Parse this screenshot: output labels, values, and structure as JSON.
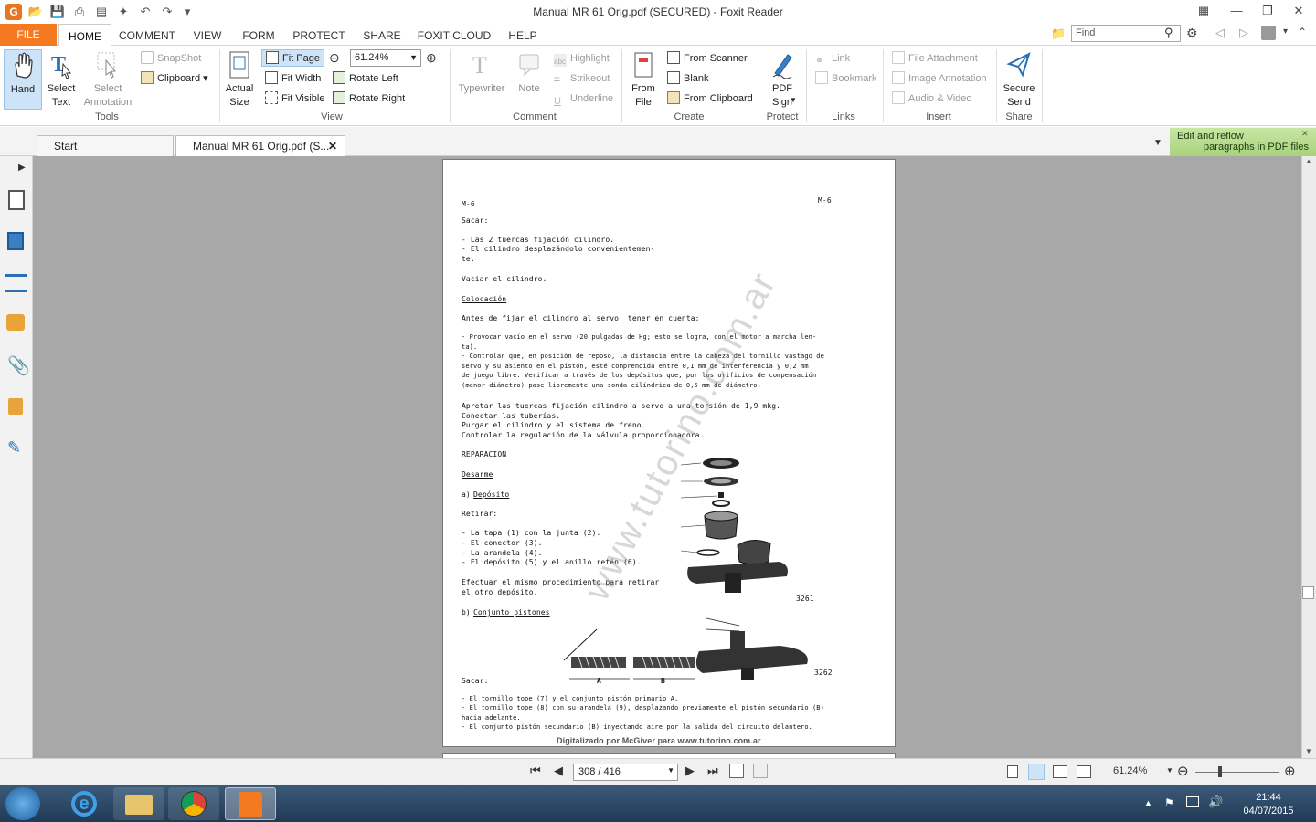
{
  "window": {
    "title": "Manual MR 61 Orig.pdf (SECURED) - Foxit Reader",
    "app_icon": "G"
  },
  "menu_tabs": [
    "FILE",
    "HOME",
    "COMMENT",
    "VIEW",
    "FORM",
    "PROTECT",
    "SHARE",
    "FOXIT CLOUD",
    "HELP"
  ],
  "search": {
    "placeholder": "Find"
  },
  "ribbon": {
    "tools": {
      "hand": "Hand",
      "select_text": "Select Text",
      "select_annotation": "Select Annotation",
      "snapshot": "SnapShot",
      "clipboard": "Clipboard",
      "group": "Tools"
    },
    "view": {
      "actual_size": "Actual Size",
      "fit_page": "Fit Page",
      "fit_width": "Fit Width",
      "fit_visible": "Fit Visible",
      "zoom": "61.24%",
      "rotate_left": "Rotate Left",
      "rotate_right": "Rotate Right",
      "group": "View"
    },
    "comment": {
      "typewriter": "Typewriter",
      "note": "Note",
      "highlight": "Highlight",
      "strikeout": "Strikeout",
      "underline": "Underline",
      "group": "Comment"
    },
    "create": {
      "from_file": "From File",
      "from_scanner": "From Scanner",
      "blank": "Blank",
      "from_clipboard": "From Clipboard",
      "group": "Create"
    },
    "protect": {
      "pdf_sign": "PDF Sign",
      "group": "Protect"
    },
    "links": {
      "link": "Link",
      "bookmark": "Bookmark",
      "group": "Links"
    },
    "insert": {
      "file_attachment": "File Attachment",
      "image_annotation": "Image Annotation",
      "audio_video": "Audio & Video",
      "group": "Insert"
    },
    "share": {
      "secure_send": "Secure Send",
      "group": "Share"
    }
  },
  "doc_tabs": {
    "start": "Start",
    "current": "Manual MR 61 Orig.pdf (S..."
  },
  "promo": {
    "line1": "Edit and reflow",
    "line2": "paragraphs in PDF files"
  },
  "page_content": {
    "header_left": "M-6",
    "header_right": "M-6",
    "sacar1": "Sacar:",
    "l1": "- Las 2 tuercas fijación cilindro.",
    "l2": "- El cilindro desplazándolo convenientemen-",
    "l3": "  te.",
    "vaciar": "Vaciar el cilindro.",
    "colocacion": "Colocación",
    "antes": "Antes de fijar el cilindro al servo, tener en cuenta:",
    "p1a": "- Provocar vacío en el servo (20 pulgadas de Hg; esto se logra, con el motor a marcha len-",
    "p1b": "  ta).",
    "p2a": "- Controlar que, en posición de reposo, la distancia entre la cabeza del tornillo vástago de",
    "p2b": "  servo y su asiento en el pistón, esté comprendida entre 0,1 mm de interferencia y 0,2 mm",
    "p2c": "  de juego libre. Verificar a través de los depósitos que, por los orificios de compensación",
    "p2d": "  (menor diámetro) pase libremente una sonda cilíndrica de 0,5 mm de diámetro.",
    "a1": "Apretar las tuercas fijación cilindro a servo a una torsión de 1,9 mkg.",
    "a2": "Conectar las tuberías.",
    "a3": "Purgar el cilindro y el sistema de freno.",
    "a4": "Controlar la regulación de la válvula proporcionadora.",
    "reparacion": "REPARACION",
    "desarme": "Desarme",
    "deposito_a": "a)",
    "deposito": "Depósito",
    "retirar": "Retirar:",
    "r1": "- La tapa (1) con la junta (2).",
    "r2": "- El conector (3).",
    "r3": "- La arandela (4).",
    "r4": "- El depósito (5) y el anillo retén (6).",
    "e1": "Efectuar el mismo procedimiento para retirar",
    "e2": "el otro depósito.",
    "b_label": "b)",
    "conjunto": "Conjunto pistones",
    "fig1": "3261",
    "fig2": "3262",
    "fig_a": "A",
    "fig_b": "B",
    "sacar2": "Sacar:",
    "s1": "- El tornillo tope (7) y el conjunto pistón primario A.",
    "s2": "- El tornillo tope (8) con su arandela (9), desplazando previamente el pistón secundario (B)",
    "s3": "  hacia adelante.",
    "s4": "- El conjunto pistón secundario (B) inyectando aire por la salida del circuito delantero.",
    "footer": "Digitalizado por McGiver para www.tutorino.com.ar",
    "watermark": "www.tutorino.com.ar"
  },
  "status": {
    "page": "308 / 416",
    "zoom": "61.24%"
  },
  "taskbar": {
    "time": "21:44",
    "date": "04/07/2015"
  }
}
